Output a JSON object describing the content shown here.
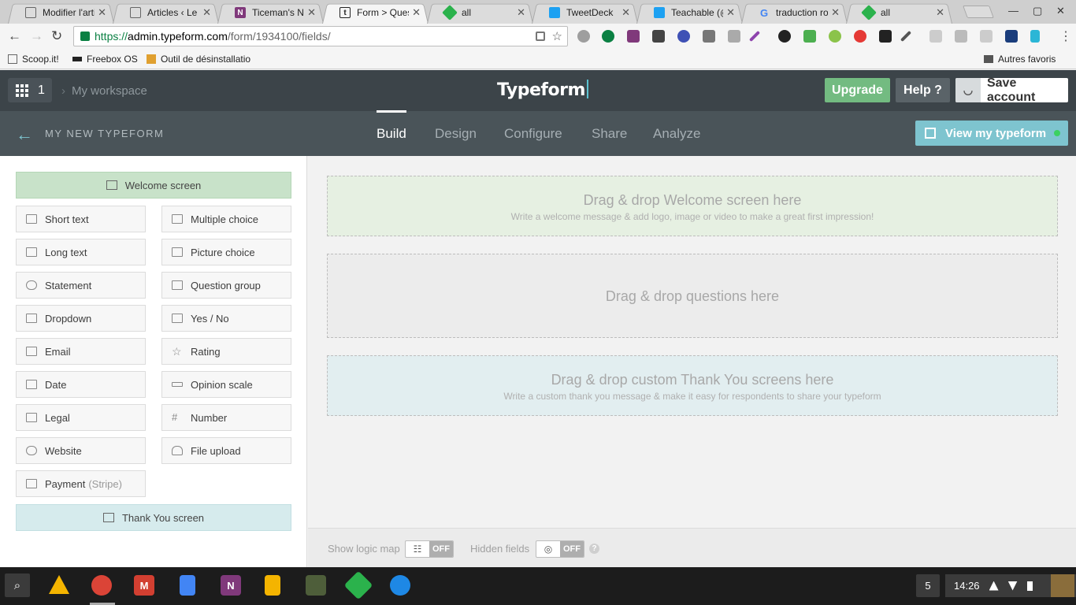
{
  "browser": {
    "tabs": [
      {
        "title": "Modifier l'artic",
        "favicon": "page-icon",
        "color": "#666666"
      },
      {
        "title": "Articles ‹ Le p",
        "favicon": "page-icon",
        "color": "#666666"
      },
      {
        "title": "Ticeman's No",
        "favicon": "onenote-icon",
        "color": "#80397b"
      },
      {
        "title": "Form > Quest",
        "favicon": "typeform-icon",
        "color": "#222222",
        "active": true
      },
      {
        "title": "all",
        "favicon": "feedly-icon",
        "color": "#2bb24c"
      },
      {
        "title": "TweetDeck",
        "favicon": "twitter-icon",
        "color": "#1da1f2"
      },
      {
        "title": "Teachable (@",
        "favicon": "twitter-icon",
        "color": "#1da1f2"
      },
      {
        "title": "traduction rou",
        "favicon": "google-icon",
        "color": "#4285f4"
      },
      {
        "title": "all",
        "favicon": "feedly-icon",
        "color": "#2bb24c"
      }
    ],
    "url_secure": "https://",
    "url_host": "admin.typeform.com",
    "url_path": "/form/1934100/fields/",
    "bookmarks": [
      "Scoop.it!",
      "Freebox OS",
      "Outil de désinstallatio",
      "Autres favoris"
    ]
  },
  "header": {
    "apps_count": "1",
    "workspace": "My workspace",
    "logo": "Typeform",
    "upgrade": "Upgrade",
    "help": "Help ?",
    "save_account": "Save account"
  },
  "subnav": {
    "form_name": "MY NEW TYPEFORM",
    "tabs": [
      "Build",
      "Design",
      "Configure",
      "Share",
      "Analyze"
    ],
    "active_tab": "Build",
    "view_button": "View my typeform"
  },
  "panel": {
    "welcome": "Welcome screen",
    "questions_left": [
      "Short text",
      "Long text",
      "Statement",
      "Dropdown",
      "Email",
      "Date",
      "Legal",
      "Website",
      "Payment"
    ],
    "questions_right": [
      "Multiple choice",
      "Picture choice",
      "Question group",
      "Yes / No",
      "Rating",
      "Opinion scale",
      "Number",
      "File upload"
    ],
    "payment_suffix": "(Stripe)",
    "thank_you": "Thank You screen"
  },
  "canvas": {
    "welcome_title": "Drag & drop Welcome screen here",
    "welcome_sub": "Write a welcome message & add logo, image or video to make a great first impression!",
    "questions_title": "Drag & drop questions here",
    "thanks_title": "Drag & drop custom Thank You screens here",
    "thanks_sub": "Write a custom thank you message & make it easy for respondents to share your typeform"
  },
  "footer": {
    "logic_map_label": "Show logic map",
    "logic_map_state": "OFF",
    "hidden_fields_label": "Hidden fields",
    "hidden_fields_state": "OFF",
    "help_mark": "?"
  },
  "taskbar": {
    "badge": "5",
    "time": "14:26"
  },
  "colors": {
    "header_bg": "#3c4449",
    "subnav_bg": "#4a5459",
    "upgrade_green": "#73bb81",
    "accent_teal": "#7ec4cf",
    "welcome_green": "#c8e2c9",
    "thanks_blue": "#d6ebed"
  }
}
